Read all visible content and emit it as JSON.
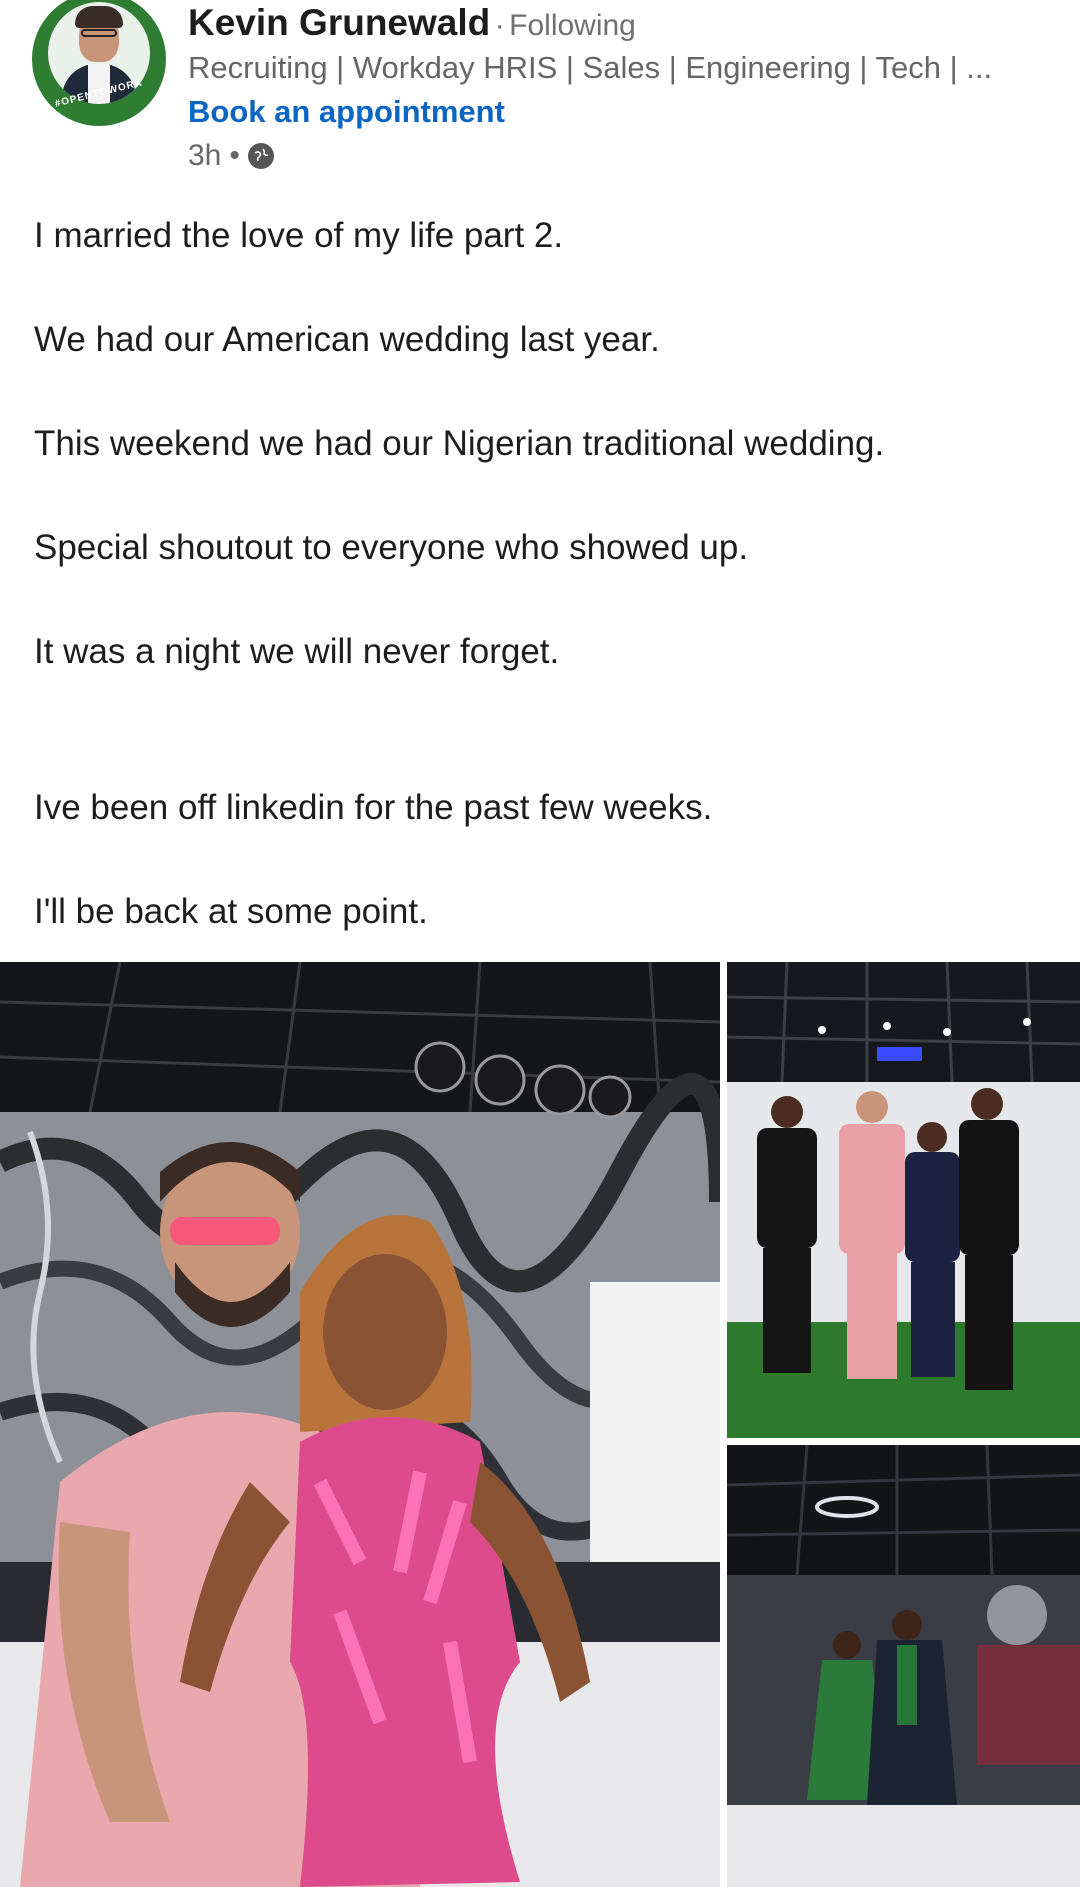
{
  "post": {
    "author": {
      "name": "Kevin Grunewald",
      "separator": "·",
      "follow_status": "Following",
      "headline": "Recruiting | Workday HRIS | Sales | Engineering | Tech | ...",
      "cta_label": "Book an appointment",
      "avatar_badge": "#OPENTOWORK"
    },
    "meta": {
      "time": "3h",
      "dot": "•",
      "visibility_icon": "globe-icon"
    },
    "body_lines": [
      "I married the love of my life part 2.",
      "We had our American wedding last year.",
      "This weekend we had our Nigerian traditional wedding.",
      "Special shoutout to everyone who showed up.",
      "It was a night we will never forget.",
      "Ive been off linkedin for the past few weeks.",
      "I'll be back at some point."
    ]
  },
  "colors": {
    "link_blue": "#0a66c2",
    "open_to_work_green": "#2f7d32",
    "text_primary": "#1d1d1d",
    "text_secondary": "#666666",
    "dress_pink": "#e0308f"
  }
}
